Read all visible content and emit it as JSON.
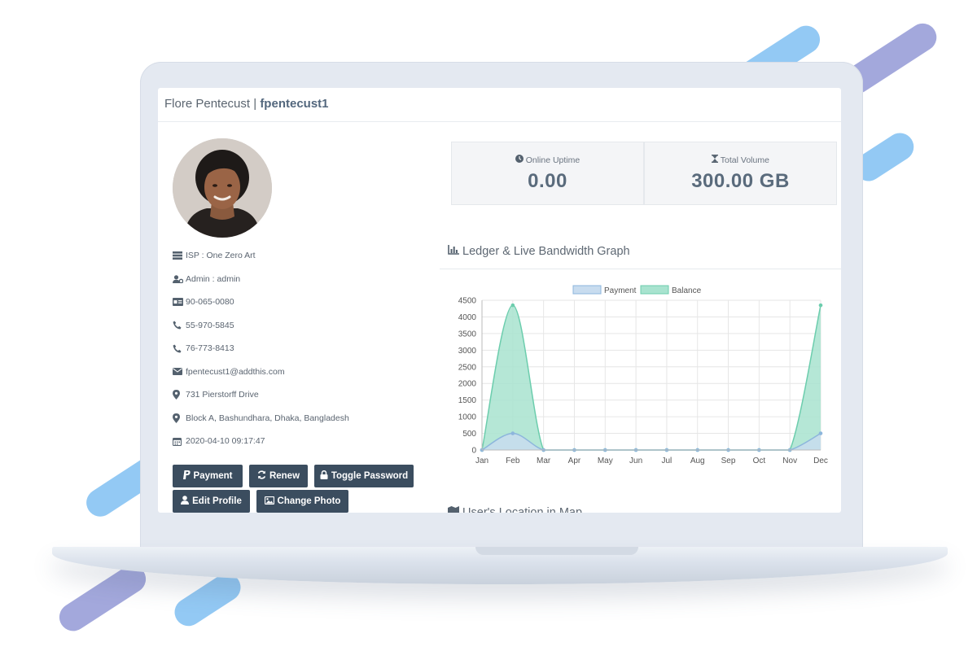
{
  "header": {
    "name": "Flore Pentecust",
    "separator": "|",
    "username": "fpentecust1"
  },
  "profile": {
    "items": [
      {
        "icon": "server-icon",
        "text": "ISP : One Zero Art"
      },
      {
        "icon": "user-cog-icon",
        "text": "Admin : admin"
      },
      {
        "icon": "id-card-icon",
        "text": "90-065-0080"
      },
      {
        "icon": "phone-icon",
        "text": "55-970-5845"
      },
      {
        "icon": "phone-icon",
        "text": "76-773-8413"
      },
      {
        "icon": "envelope-icon",
        "text": "fpentecust1@addthis.com"
      },
      {
        "icon": "map-marker-icon",
        "text": "731 Pierstorff Drive"
      },
      {
        "icon": "map-marker-icon",
        "text": "Block A, Bashundhara, Dhaka, Bangladesh"
      },
      {
        "icon": "calendar-icon",
        "text": "2020-04-10 09:17:47"
      }
    ]
  },
  "buttons": {
    "payment": "Payment",
    "renew": "Renew",
    "toggle_password": "Toggle Password",
    "edit_profile": "Edit Profile",
    "change_photo": "Change Photo"
  },
  "stats": {
    "uptime_label": "Online Uptime",
    "uptime_value": "0.00",
    "volume_label": "Total Volume",
    "volume_value": "300.00 GB"
  },
  "ledger": {
    "title": "Ledger & Live Bandwidth Graph"
  },
  "map": {
    "title": "User's Location in Map"
  },
  "colors": {
    "button": "#3b4d5f",
    "payment_fill": "#c8dcef",
    "payment_line": "#8db6dc",
    "balance_fill": "#a8e3cf",
    "balance_line": "#6ccdad",
    "stripe_blue": "#93c9f4",
    "stripe_purple": "#a3a8dc"
  },
  "chart_data": {
    "type": "area",
    "categories": [
      "Jan",
      "Feb",
      "Mar",
      "Apr",
      "May",
      "Jun",
      "Jul",
      "Aug",
      "Sep",
      "Oct",
      "Nov",
      "Dec"
    ],
    "series": [
      {
        "name": "Payment",
        "values": [
          0,
          500,
          0,
          0,
          0,
          0,
          0,
          0,
          0,
          0,
          0,
          500
        ]
      },
      {
        "name": "Balance",
        "values": [
          0,
          4350,
          0,
          0,
          0,
          0,
          0,
          0,
          0,
          0,
          0,
          4350
        ]
      }
    ],
    "yticks": [
      0,
      500,
      1000,
      1500,
      2000,
      2500,
      3000,
      3500,
      4000,
      4500
    ],
    "ylim": [
      0,
      4500
    ],
    "grid": true,
    "legend": "top"
  }
}
